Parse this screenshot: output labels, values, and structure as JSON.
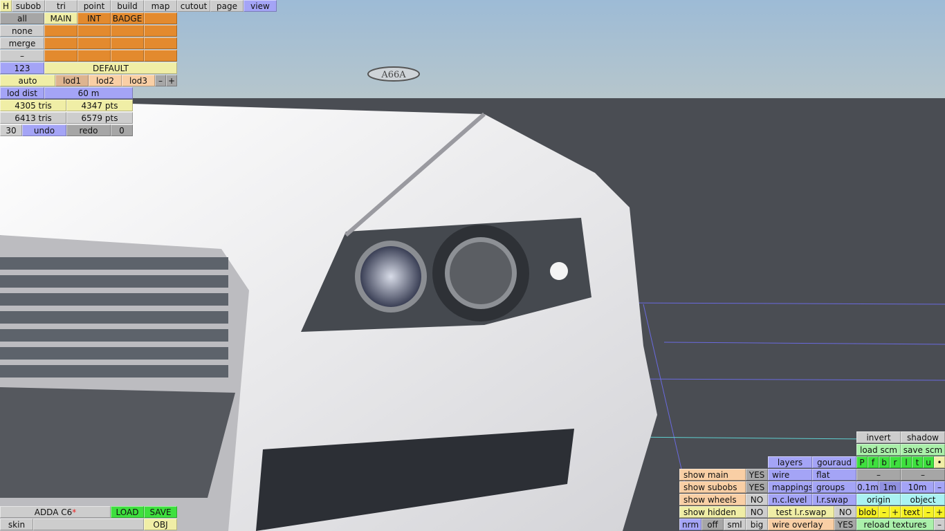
{
  "menu": {
    "h": "H",
    "tabs": [
      "subob",
      "tri",
      "point",
      "build",
      "map",
      "cutout",
      "page",
      "view"
    ]
  },
  "subobs": {
    "all": "all",
    "none": "none",
    "merge": "merge",
    "dash": "–",
    "num": "123",
    "names": [
      "MAIN",
      "INT",
      "BADGE"
    ],
    "default": "DEFAULT"
  },
  "lod": {
    "auto": "auto",
    "lod1": "lod1",
    "lod2": "lod2",
    "lod3": "lod3",
    "minus": "–",
    "plus": "+",
    "dist_label": "lod dist",
    "dist": "60 m",
    "tris1": "4305 tris",
    "pts1": "4347 pts",
    "tris2": "6413 tris",
    "pts2": "6579 pts",
    "undo_count": "30",
    "undo": "undo",
    "redo": "redo",
    "redo_count": "0"
  },
  "file": {
    "name": "ADDA C6",
    "modified": "*",
    "load": "LOAD",
    "save": "SAVE",
    "skin": "skin",
    "obj": "OBJ"
  },
  "badge_text": "A66A",
  "view": {
    "invert": "invert",
    "shadow": "shadow",
    "load_scm": "load scm",
    "save_scm": "save scm",
    "layers": "layers",
    "gouraud": "gouraud",
    "views": [
      "P",
      "f",
      "b",
      "r",
      "l",
      "t",
      "u",
      "•"
    ],
    "show_main": "show main",
    "show_main_v": "YES",
    "wire": "wire",
    "flat": "flat",
    "dash": "–",
    "show_subobs": "show subobs",
    "show_subobs_v": "YES",
    "mappings": "mappings",
    "groups": "groups",
    "g01": "0.1m",
    "g1": "1m",
    "g10": "10m",
    "show_wheels": "show wheels",
    "show_wheels_v": "NO",
    "nclevel": "n.c.level",
    "lrswap": "l.r.swap",
    "origin": "origin",
    "object": "object",
    "show_hidden": "show hidden",
    "show_hidden_v": "NO",
    "test_lrswap": "test l.r.swap",
    "test_lrswap_v": "NO",
    "blob": "blob",
    "text": "text",
    "minus": "–",
    "plus": "+",
    "nrm": "nrm",
    "off": "off",
    "sml": "sml",
    "big": "big",
    "wire_overlay": "wire overlay",
    "wire_overlay_v": "YES",
    "reload": "reload textures"
  }
}
